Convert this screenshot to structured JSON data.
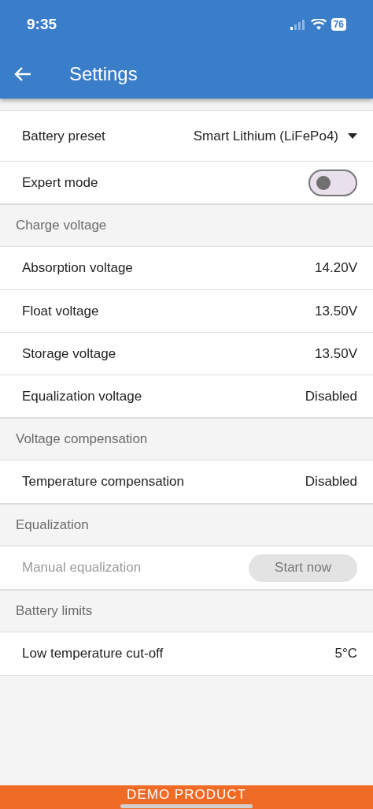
{
  "status_bar": {
    "time": "9:35",
    "battery": "76"
  },
  "app_bar": {
    "title": "Settings"
  },
  "sections": [
    {
      "items": [
        {
          "kind": "select",
          "label": "Battery preset",
          "value": "Smart Lithium (LiFePo4)"
        },
        {
          "kind": "toggle",
          "label": "Expert mode",
          "on": false
        }
      ]
    },
    {
      "title": "Charge voltage",
      "items": [
        {
          "kind": "value",
          "label": "Absorption voltage",
          "value": "14.20V"
        },
        {
          "kind": "value",
          "label": "Float voltage",
          "value": "13.50V"
        },
        {
          "kind": "value",
          "label": "Storage voltage",
          "value": "13.50V"
        },
        {
          "kind": "value",
          "label": "Equalization voltage",
          "value": "Disabled"
        }
      ]
    },
    {
      "title": "Voltage compensation",
      "items": [
        {
          "kind": "value",
          "label": "Temperature compensation",
          "value": "Disabled"
        }
      ]
    },
    {
      "title": "Equalization",
      "items": [
        {
          "kind": "button",
          "label": "Manual equalization",
          "button": "Start now",
          "disabled": true
        }
      ]
    },
    {
      "title": "Battery limits",
      "items": [
        {
          "kind": "value",
          "label": "Low temperature cut-off",
          "value": "5°C"
        }
      ]
    }
  ],
  "footer": {
    "text": "DEMO PRODUCT"
  }
}
